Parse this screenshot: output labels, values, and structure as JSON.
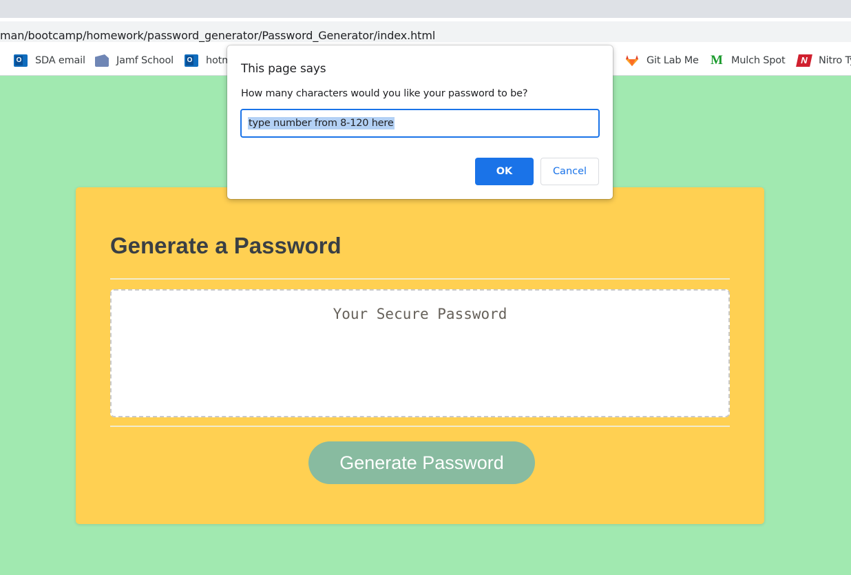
{
  "browser": {
    "url": "man/bootcamp/homework/password_generator/Password_Generator/index.html",
    "bookmarks": [
      {
        "label": "SDA email",
        "icon": "outlook-icon"
      },
      {
        "label": "Jamf School",
        "icon": "jamf-icon"
      },
      {
        "label": "hotm",
        "icon": "outlook-icon"
      },
      {
        "label": "Git Lab Me",
        "icon": "gitlab-icon"
      },
      {
        "label": "Mulch Spot",
        "icon": "mulch-icon"
      },
      {
        "label": "Nitro Ty",
        "icon": "nitro-icon"
      }
    ]
  },
  "page": {
    "title": "Generate a Password",
    "password_placeholder": "Your Secure Password",
    "generate_button": "Generate Password",
    "colors": {
      "background": "#a1e9b0",
      "card": "#ffd052",
      "button": "#88bba0"
    }
  },
  "dialog": {
    "title": "This page says",
    "message": "How many characters would you like your password to be?",
    "input_value": "type number from 8-120 here",
    "ok_label": "OK",
    "cancel_label": "Cancel",
    "accent": "#1a73e8"
  }
}
